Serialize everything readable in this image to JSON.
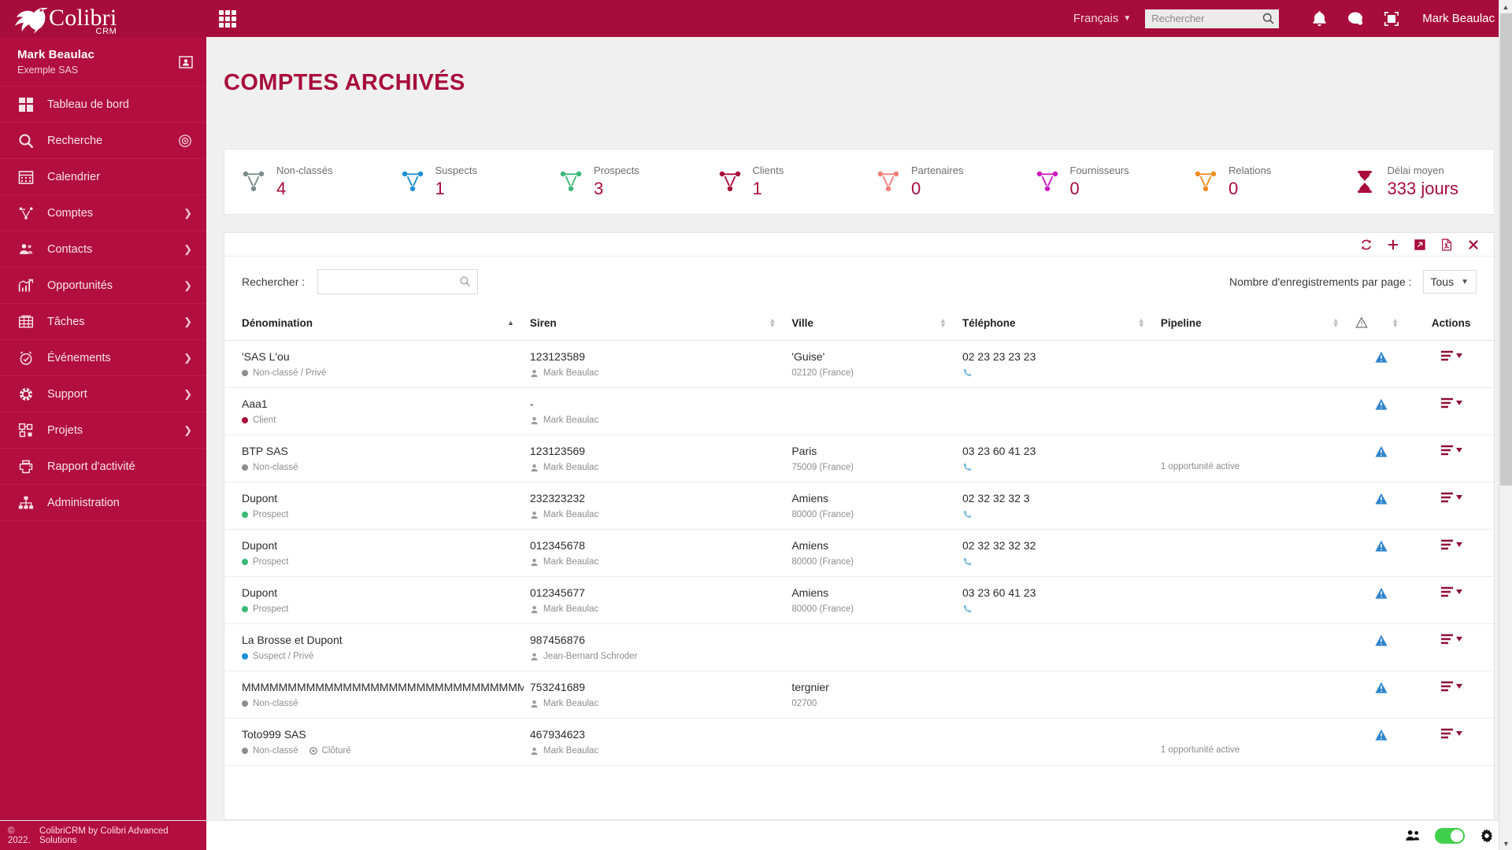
{
  "brand": {
    "name": "Colibri",
    "sub": "CRM"
  },
  "topbar": {
    "language": "Français",
    "search_placeholder": "Rechercher",
    "search_value": "",
    "user": "Mark Beaulac",
    "icons": [
      "apps-grid-icon",
      "bell-icon",
      "chat-icon",
      "fullscreen-icon"
    ]
  },
  "sidebar": {
    "user_name": "Mark Beaulac",
    "company": "Exemple SAS",
    "items": [
      {
        "label": "Tableau de bord",
        "icon": "dashboard-icon",
        "arrow": false,
        "target": false
      },
      {
        "label": "Recherche",
        "icon": "search-icon",
        "arrow": false,
        "target": true
      },
      {
        "label": "Calendrier",
        "icon": "calendar-icon",
        "arrow": false,
        "target": false
      },
      {
        "label": "Comptes",
        "icon": "accounts-network-icon",
        "arrow": true,
        "target": false
      },
      {
        "label": "Contacts",
        "icon": "contacts-icon",
        "arrow": true,
        "target": false
      },
      {
        "label": "Opportunités",
        "icon": "chart-growth-icon",
        "arrow": true,
        "target": false
      },
      {
        "label": "Tâches",
        "icon": "table-tasks-icon",
        "arrow": true,
        "target": false
      },
      {
        "label": "Événements",
        "icon": "alarm-clock-icon",
        "arrow": true,
        "target": false
      },
      {
        "label": "Support",
        "icon": "lifebuoy-icon",
        "arrow": true,
        "target": false
      },
      {
        "label": "Projets",
        "icon": "projects-icon",
        "arrow": true,
        "target": false
      },
      {
        "label": "Rapport d'activité",
        "icon": "printer-icon",
        "arrow": false,
        "target": false
      },
      {
        "label": "Administration",
        "icon": "sitemap-icon",
        "arrow": false,
        "target": false
      }
    ]
  },
  "page": {
    "title": "COMPTES ARCHIVÉS"
  },
  "stats": [
    {
      "label": "Non-classés",
      "value": "4",
      "color": "#7b8a8b",
      "icon": "network-icon"
    },
    {
      "label": "Suspects",
      "value": "1",
      "color": "#1e8fd5",
      "icon": "network-icon"
    },
    {
      "label": "Prospects",
      "value": "3",
      "color": "#3cb878",
      "icon": "network-icon"
    },
    {
      "label": "Clients",
      "value": "1",
      "color": "#a80c3c",
      "icon": "network-icon"
    },
    {
      "label": "Partenaires",
      "value": "0",
      "color": "#ef7d78",
      "icon": "network-icon"
    },
    {
      "label": "Fournisseurs",
      "value": "0",
      "color": "#cc1bc0",
      "icon": "network-icon"
    },
    {
      "label": "Relations",
      "value": "0",
      "color": "#ef8b22",
      "icon": "network-icon"
    },
    {
      "label": "Délai moyen",
      "value": "333 jours",
      "color": "#a80c3c",
      "icon": "hourglass-icon"
    }
  ],
  "toolbar_icons": [
    "refresh-icon",
    "add-icon",
    "export-icon",
    "pdf-icon",
    "close-icon"
  ],
  "filters": {
    "search_label": "Rechercher :",
    "search_value": "",
    "search_placeholder": "",
    "per_page_label": "Nombre d'enregistrements par page :",
    "per_page_value": "Tous"
  },
  "table": {
    "columns": [
      {
        "label": "Dénomination",
        "sort": "asc"
      },
      {
        "label": "Siren",
        "sort": "none"
      },
      {
        "label": "Ville",
        "sort": "none"
      },
      {
        "label": "Téléphone",
        "sort": "none"
      },
      {
        "label": "Pipeline",
        "sort": "none"
      },
      {
        "label": "",
        "sort": "none",
        "icon": "warning-triangle-icon"
      },
      {
        "label": "Actions",
        "sort": null
      }
    ],
    "rows": [
      {
        "name": "'SAS L'ou",
        "status": "Non-classé / Privé",
        "status_color": "#8d8d8d",
        "siren": "123123589",
        "owner": "Mark Beaulac",
        "city": "'Guise'",
        "postal": "02120 (France)",
        "phone": "02 23 23 23 23",
        "phone_icon": true,
        "pipeline": ""
      },
      {
        "name": "Aaa1",
        "status": "Client",
        "status_color": "#a80c3c",
        "siren": "-",
        "owner": "Mark Beaulac",
        "city": "",
        "postal": "",
        "phone": "",
        "phone_icon": false,
        "pipeline": ""
      },
      {
        "name": "BTP SAS",
        "status": "Non-classé",
        "status_color": "#8d8d8d",
        "siren": "123123569",
        "owner": "Mark Beaulac",
        "city": "Paris",
        "postal": "75009 (France)",
        "phone": "03 23 60 41 23",
        "phone_icon": true,
        "pipeline": "1 opportunité active"
      },
      {
        "name": "Dupont",
        "status": "Prospect",
        "status_color": "#3cb878",
        "siren": "232323232",
        "owner": "Mark Beaulac",
        "city": "Amiens",
        "postal": "80000 (France)",
        "phone": "02 32 32 32 3",
        "phone_icon": true,
        "pipeline": ""
      },
      {
        "name": "Dupont",
        "status": "Prospect",
        "status_color": "#3cb878",
        "siren": "012345678",
        "owner": "Mark Beaulac",
        "city": "Amiens",
        "postal": "80000 (France)",
        "phone": "02 32 32 32 32",
        "phone_icon": true,
        "pipeline": ""
      },
      {
        "name": "Dupont",
        "status": "Prospect",
        "status_color": "#3cb878",
        "siren": "012345677",
        "owner": "Mark Beaulac",
        "city": "Amiens",
        "postal": "80000 (France)",
        "phone": "03 23 60 41 23",
        "phone_icon": true,
        "pipeline": ""
      },
      {
        "name": "La Brosse et Dupont",
        "status": "Suspect / Privé",
        "status_color": "#1e8fd5",
        "siren": "987456876",
        "owner": "Jean-Bernard Schroder",
        "city": "",
        "postal": "",
        "phone": "",
        "phone_icon": false,
        "pipeline": ""
      },
      {
        "name": "MMMMMMMMMMMMMMMMMMMMMMMMMMMMMMMMM",
        "status": "Non-classé",
        "status_color": "#8d8d8d",
        "siren": "753241689",
        "owner": "Mark Beaulac",
        "city": "tergnier",
        "postal": "02700",
        "phone": "",
        "phone_icon": false,
        "pipeline": ""
      },
      {
        "name": "Toto999 SAS",
        "status": "Non-classé",
        "status_color": "#8d8d8d",
        "status2": "Clôturé",
        "siren": "467934623",
        "owner": "Mark Beaulac",
        "city": "",
        "postal": "",
        "phone": "",
        "phone_icon": false,
        "pipeline": "1 opportunité active"
      }
    ]
  },
  "footer": {
    "copyright": "© 2022. ",
    "link": "ColibriCRM by Colibri Advanced Solutions",
    "toggle_on": true,
    "icons": [
      "users-icon",
      "toggle-switch",
      "gear-icon"
    ]
  },
  "colors": {
    "brand": "#a80c3c",
    "sidebar": "#b20e40",
    "accent_green": "#3fcf4a"
  }
}
